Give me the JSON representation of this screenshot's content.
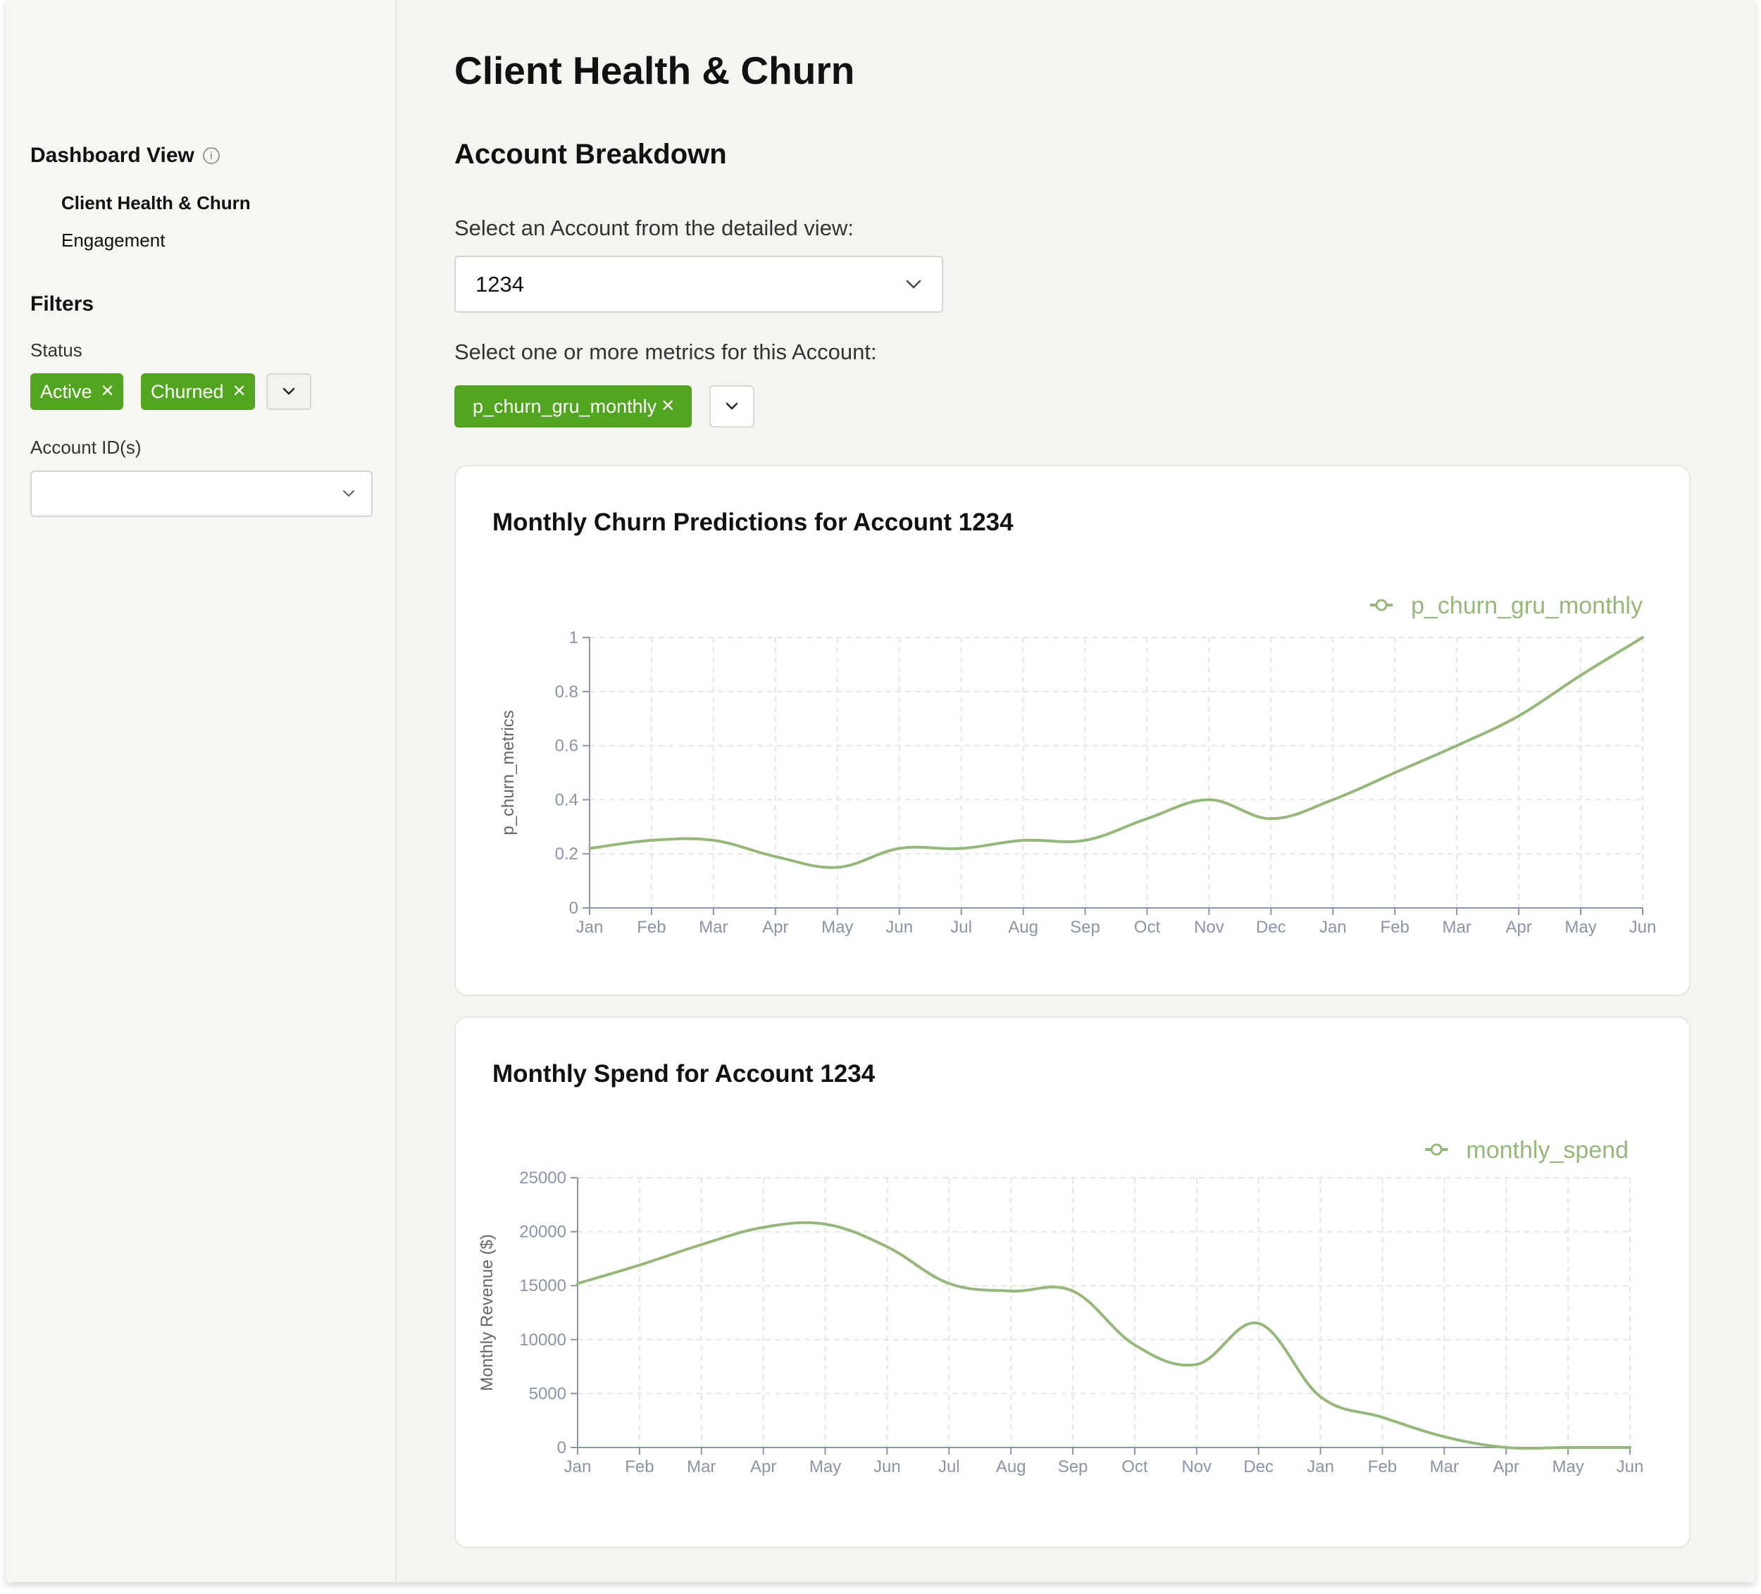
{
  "sidebar": {
    "dashboard_view_title": "Dashboard View",
    "nav_items": [
      {
        "label": "Client Health & Churn",
        "active": true
      },
      {
        "label": "Engagement",
        "active": false
      }
    ],
    "filters_title": "Filters",
    "status_label": "Status",
    "status_chips": [
      "Active",
      "Churned"
    ],
    "account_ids_label": "Account ID(s)",
    "account_ids_value": ""
  },
  "main": {
    "title": "Client Health & Churn",
    "section_title": "Account Breakdown",
    "account_select_label": "Select an Account from the detailed view:",
    "account_select_value": "1234",
    "metrics_label": "Select one or more metrics for this Account:",
    "metric_chips": [
      "p_churn_gru_monthly"
    ]
  },
  "colors": {
    "accent": "#52a51f",
    "line": "#95b87a",
    "axis": "#8a93a8",
    "grid": "#e6e6e6"
  },
  "icons": {
    "info": "info-circle-icon",
    "chip_remove": "close-icon",
    "dropdown": "chevron-down-icon",
    "legend": "line-with-circle-icon"
  },
  "chart_data": [
    {
      "type": "line",
      "title": "Monthly Churn Predictions for Account 1234",
      "ylabel": "p_churn_metrics",
      "xlabel": "",
      "categories": [
        "Jan",
        "Feb",
        "Mar",
        "Apr",
        "May",
        "Jun",
        "Jul",
        "Aug",
        "Sep",
        "Oct",
        "Nov",
        "Dec",
        "Jan",
        "Feb",
        "Mar",
        "Apr",
        "May",
        "Jun"
      ],
      "series": [
        {
          "name": "p_churn_gru_monthly",
          "values": [
            0.22,
            0.25,
            0.25,
            0.19,
            0.15,
            0.22,
            0.22,
            0.25,
            0.25,
            0.33,
            0.4,
            0.33,
            0.4,
            0.5,
            0.6,
            0.71,
            0.86,
            1.0
          ]
        }
      ],
      "ylim": [
        0,
        1
      ],
      "yticks": [
        "0",
        "0.2",
        "0.4",
        "0.6",
        "0.8",
        "1"
      ],
      "grid": true,
      "legend": "top-right"
    },
    {
      "type": "line",
      "title": "Monthly Spend for Account 1234",
      "ylabel": "Monthly Revenue ($)",
      "xlabel": "",
      "categories": [
        "Jan",
        "Feb",
        "Mar",
        "Apr",
        "May",
        "Jun",
        "Jul",
        "Aug",
        "Sep",
        "Oct",
        "Nov",
        "Dec",
        "Jan",
        "Feb",
        "Mar",
        "Apr",
        "May",
        "Jun"
      ],
      "series": [
        {
          "name": "monthly_spend",
          "values": [
            15200,
            16900,
            18800,
            20400,
            20700,
            18600,
            15200,
            14500,
            14500,
            9500,
            7700,
            11500,
            4700,
            2800,
            1000,
            0,
            0,
            0
          ]
        }
      ],
      "ylim": [
        0,
        25000
      ],
      "yticks": [
        "0",
        "5000",
        "10000",
        "15000",
        "20000",
        "25000"
      ],
      "grid": true,
      "legend": "top-right"
    }
  ]
}
